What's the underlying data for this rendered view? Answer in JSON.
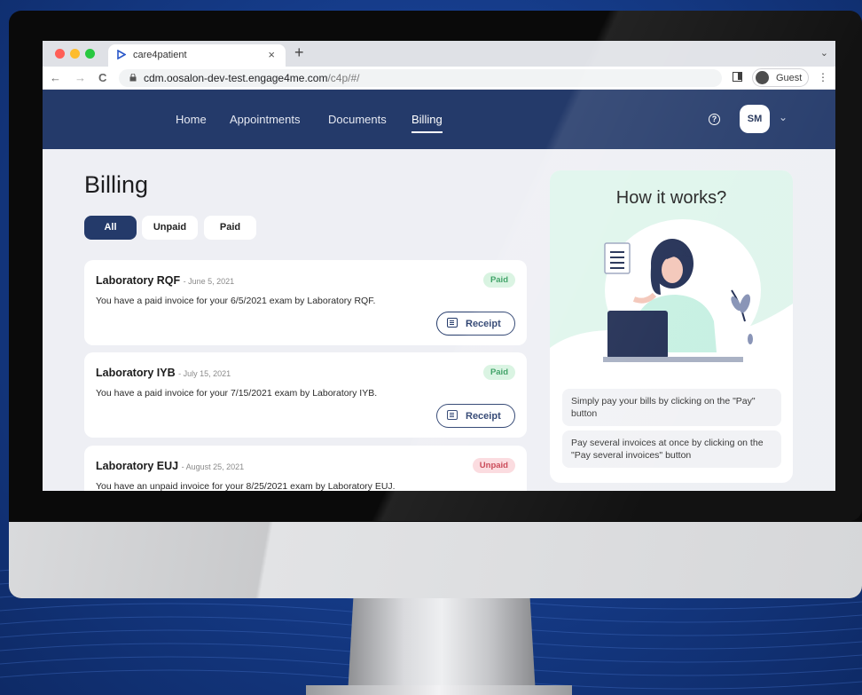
{
  "browser": {
    "tab_title": "care4patient",
    "tab_close": "×",
    "new_tab": "+",
    "tab_menu": "⌄",
    "back": "←",
    "forward": "→",
    "reload": "C",
    "url_host": "cdm.oosalon-dev-test.engage4me.com",
    "url_path": "/c4p/#/",
    "profile_label": "Guest",
    "menu": "⋮"
  },
  "nav": {
    "items": [
      "Home",
      "Appointments",
      "Documents",
      "Billing"
    ],
    "active": "Billing",
    "help": "?",
    "avatar_initials": "SM",
    "avatar_chevron": "⌄"
  },
  "billing": {
    "title": "Billing",
    "filters": [
      "All",
      "Unpaid",
      "Paid"
    ],
    "active_filter": "All",
    "invoices": [
      {
        "lab": "Laboratory RQF",
        "date": "- June 5, 2021",
        "description": "You have a paid invoice for your 6/5/2021 exam by Laboratory RQF.",
        "status": "Paid",
        "action": "Receipt"
      },
      {
        "lab": "Laboratory IYB",
        "date": "- July 15, 2021",
        "description": "You have a paid invoice for your 7/15/2021 exam by Laboratory IYB.",
        "status": "Paid",
        "action": "Receipt"
      },
      {
        "lab": "Laboratory EUJ",
        "date": "- August 25, 2021",
        "description": "You have an unpaid invoice for your 8/25/2021 exam by Laboratory EUJ.",
        "status": "Unpaid"
      }
    ]
  },
  "how_it_works": {
    "title": "How it works?",
    "tips": [
      "Simply pay your bills by clicking on the \"Pay\" button",
      "Pay several invoices at once by clicking on the \"Pay several invoices\" button"
    ]
  },
  "colors": {
    "nav_bg": "#243a6a",
    "paid_badge": "#2f9a5a",
    "unpaid_badge": "#c63b4b",
    "page_bg": "#eeeff4"
  }
}
